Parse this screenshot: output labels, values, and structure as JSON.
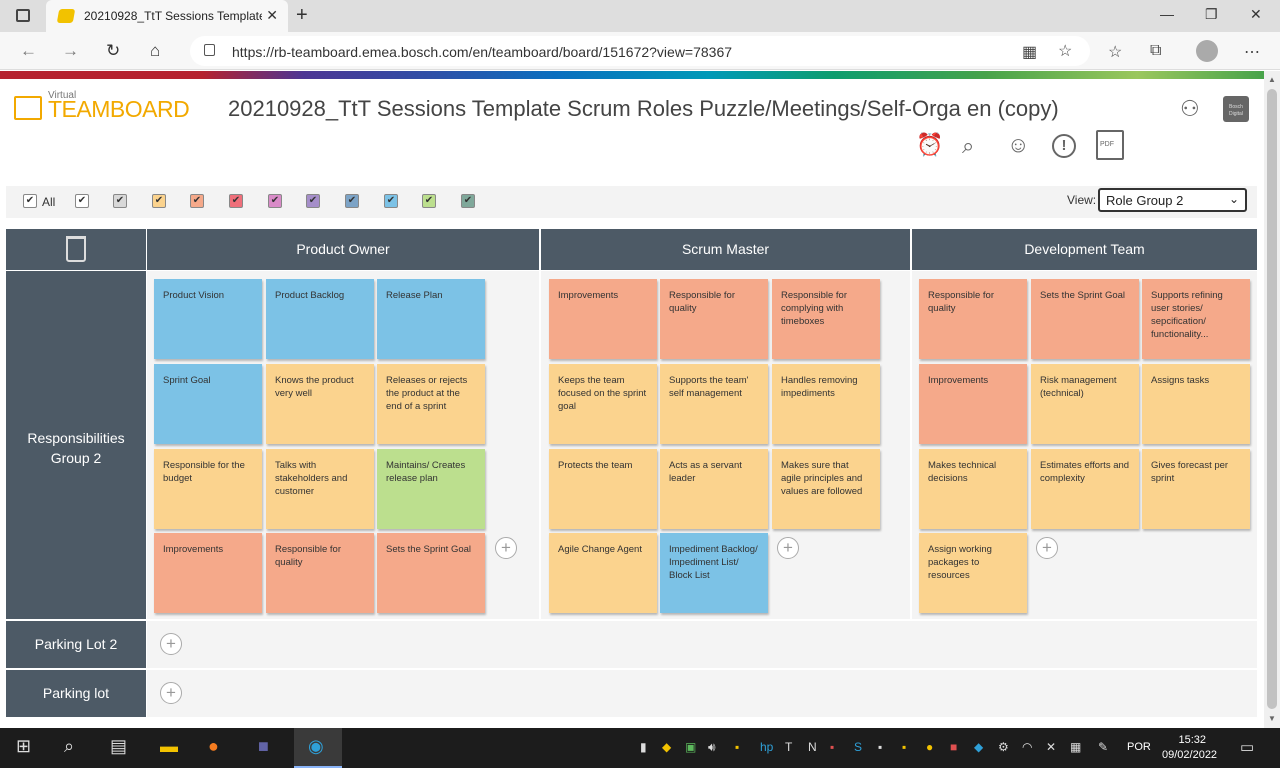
{
  "browser": {
    "tab_title": "20210928_TtT Sessions Template",
    "url": "https://rb-teamboard.emea.bosch.com/en/teamboard/board/151672?view=78367"
  },
  "app": {
    "logo_small": "Virtual",
    "logo_big": "TEAMBOARD",
    "board_title": "20210928_TtT Sessions Template Scrum Roles Puzzle/Meetings/Self-Orga en (copy)",
    "pdf_label": "PDF",
    "avatar_text": "Bosch Digital"
  },
  "filters": {
    "all_label": "All",
    "view_label": "View:",
    "view_value": "Role Group 2",
    "swatches": [
      "#ffffff",
      "#d8d8d8",
      "#fbd38e",
      "#f5a98a",
      "#ef6f7a",
      "#d98bc8",
      "#a58ec9",
      "#7ca3c6",
      "#7cc2e6",
      "#bcdf8e",
      "#7fa89a"
    ]
  },
  "columns": [
    "Product Owner",
    "Scrum Master",
    "Development Team"
  ],
  "rows": {
    "main": "Responsibilities Group 2",
    "parking2": "Parking Lot 2",
    "parking": "Parking lot"
  },
  "cards": {
    "po": [
      {
        "text": "Product Vision",
        "color": "blue"
      },
      {
        "text": "Product Backlog",
        "color": "blue"
      },
      {
        "text": "Release Plan",
        "color": "blue"
      },
      {
        "text": "Sprint Goal",
        "color": "blue"
      },
      {
        "text": "Knows the product very well",
        "color": "yellow"
      },
      {
        "text": "Releases or rejects the product at the end of a sprint",
        "color": "yellow"
      },
      {
        "text": "Responsible for the budget",
        "color": "yellow"
      },
      {
        "text": "Talks with stakeholders and customer",
        "color": "yellow"
      },
      {
        "text": "Maintains/ Creates release plan",
        "color": "green"
      },
      {
        "text": "Improvements",
        "color": "orange"
      },
      {
        "text": "Responsible for quality",
        "color": "orange"
      },
      {
        "text": "Sets the Sprint Goal",
        "color": "orange"
      }
    ],
    "sm": [
      {
        "text": "Improvements",
        "color": "orange"
      },
      {
        "text": "Responsible for quality",
        "color": "orange"
      },
      {
        "text": "Responsible for complying with timeboxes",
        "color": "orange"
      },
      {
        "text": "Keeps the team focused on the sprint goal",
        "color": "yellow"
      },
      {
        "text": "Supports the team' self management",
        "color": "yellow"
      },
      {
        "text": "Handles removing impediments",
        "color": "yellow"
      },
      {
        "text": "Protects the team",
        "color": "yellow"
      },
      {
        "text": "Acts as a servant leader",
        "color": "yellow"
      },
      {
        "text": "Makes sure that agile principles and values are followed",
        "color": "yellow"
      },
      {
        "text": "Agile Change Agent",
        "color": "yellow"
      },
      {
        "text": "Impediment Backlog/ Impediment List/ Block List",
        "color": "blue"
      }
    ],
    "dt": [
      {
        "text": "Responsible for quality",
        "color": "orange"
      },
      {
        "text": "Sets the Sprint Goal",
        "color": "orange"
      },
      {
        "text": "Supports refining user stories/ sepcification/ functionality...",
        "color": "orange"
      },
      {
        "text": "Improvements",
        "color": "orange"
      },
      {
        "text": "Risk management (technical)",
        "color": "yellow"
      },
      {
        "text": "Assigns tasks",
        "color": "yellow"
      },
      {
        "text": "Makes technical decisions",
        "color": "yellow"
      },
      {
        "text": "Estimates efforts and complexity",
        "color": "yellow"
      },
      {
        "text": "Gives forecast per sprint",
        "color": "yellow"
      },
      {
        "text": "Assign working packages to resources",
        "color": "yellow"
      }
    ]
  },
  "taskbar": {
    "lang": "POR",
    "time": "15:32",
    "date": "09/02/2022"
  }
}
